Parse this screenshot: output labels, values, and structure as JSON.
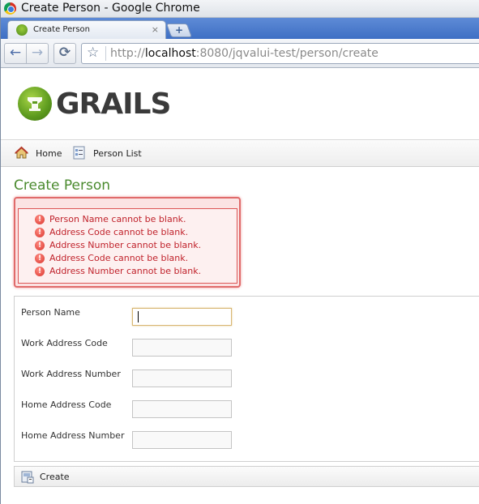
{
  "window": {
    "title": "Create Person - Google Chrome"
  },
  "tab": {
    "label": "Create Person",
    "close": "×"
  },
  "toolbar": {
    "url_prefix": "http://",
    "url_host": "localhost",
    "url_rest": ":8080/jqvalui-test/person/create"
  },
  "header": {
    "logo_text": "GRAILS"
  },
  "nav": {
    "home": "Home",
    "person_list": "Person List"
  },
  "page": {
    "heading": "Create Person"
  },
  "errors": [
    "Person Name cannot be blank.",
    "Address Code cannot be blank.",
    "Address Number cannot be blank.",
    "Address Code cannot be blank.",
    "Address Number cannot be blank."
  ],
  "form": {
    "fields": [
      {
        "label": "Person Name",
        "value": ""
      },
      {
        "label": "Work Address Code",
        "value": ""
      },
      {
        "label": "Work Address Number",
        "value": ""
      },
      {
        "label": "Home Address Code",
        "value": ""
      },
      {
        "label": "Home Address Number",
        "value": ""
      }
    ],
    "submit_label": "Create"
  },
  "colors": {
    "heading": "#4a8a2e",
    "error_text": "#c0222b",
    "error_border": "#e06b6b"
  }
}
